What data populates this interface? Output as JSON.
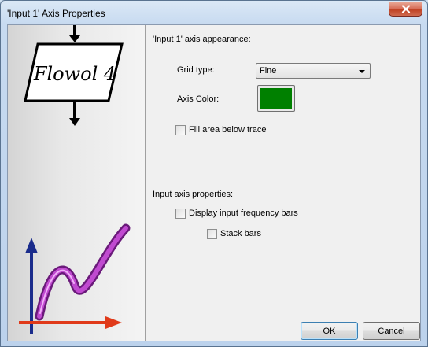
{
  "window": {
    "title": "'Input 1' Axis Properties",
    "close_label": "x"
  },
  "appearance": {
    "heading": "'Input 1' axis appearance:",
    "grid_type_label": "Grid type:",
    "grid_type_value": "Fine",
    "axis_color_label": "Axis Color:",
    "axis_color": "#008000",
    "fill_area_label": "Fill area below trace",
    "fill_area_checked": false
  },
  "input_axis": {
    "heading": "Input axis properties:",
    "display_bars_label": "Display input frequency bars",
    "display_bars_checked": false,
    "stack_bars_label": "Stack bars",
    "stack_bars_checked": false
  },
  "buttons": {
    "ok_label": "OK",
    "cancel_label": "Cancel"
  },
  "logo": {
    "text": "Flowol 4"
  },
  "icons": {
    "close": "close-icon",
    "dropdown": "chevron-down-icon",
    "logo": "flowol-logo",
    "graph": "graph-illustration"
  }
}
